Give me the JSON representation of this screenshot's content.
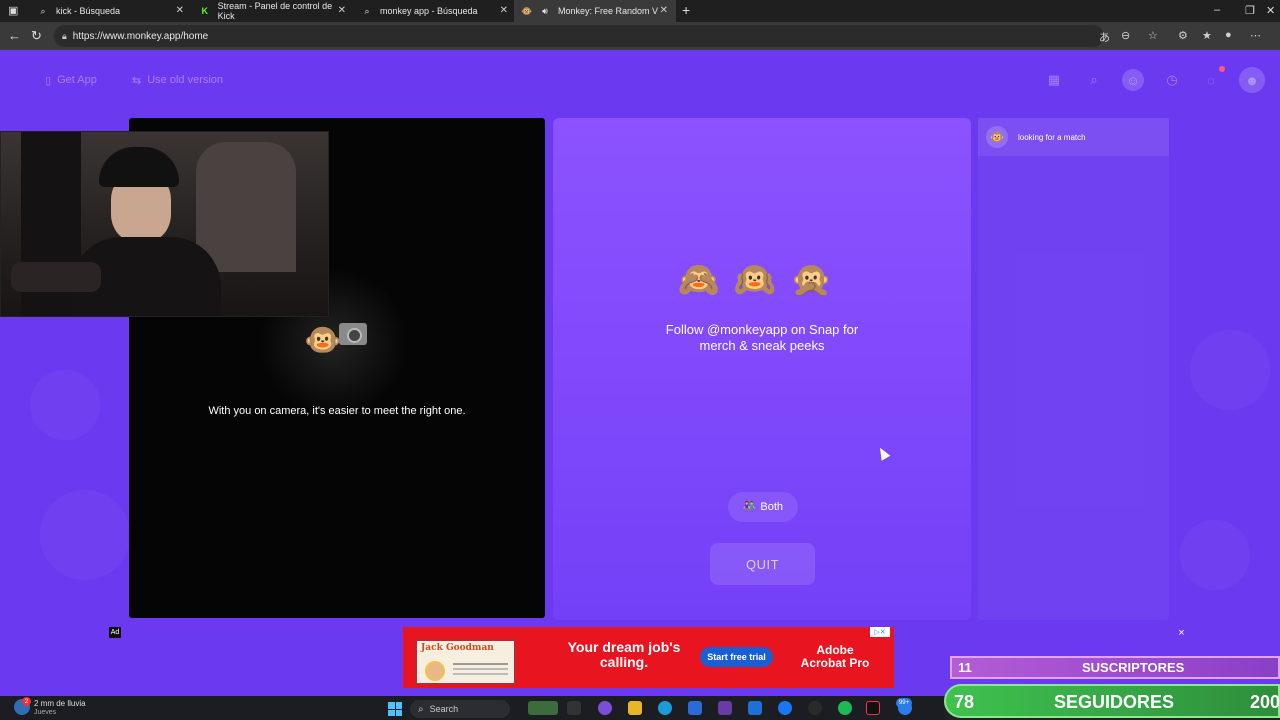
{
  "browser": {
    "tabs": [
      {
        "label": "kick - Búsqueda",
        "icon": "search-icon"
      },
      {
        "label": "Stream - Panel de control de Kick",
        "icon": "kick-icon"
      },
      {
        "label": "monkey app - Búsqueda",
        "icon": "search-icon"
      },
      {
        "label": "Monkey: Free Random Video",
        "icon": "monkey-icon"
      }
    ],
    "new_tab": "+",
    "url": "https://www.monkey.app/home"
  },
  "nav": {
    "get_app": "Get App",
    "use_old_version": "Use old version"
  },
  "video": {
    "camera_prompt": "With you on camera, it's easier to meet the right one."
  },
  "center": {
    "monkeys": "🙈🙉🙊",
    "follow_text": "Follow @monkeyapp on Snap for merch & sneak peeks",
    "both_label": "Both",
    "quit_label": "QUIT"
  },
  "chat": {
    "status": "looking for a match"
  },
  "ad": {
    "label": "Ad",
    "card_title": "Jack Goodman",
    "headline": "Your dream job's calling.",
    "cta": "Start free trial",
    "brand": "Adobe Acrobat Pro",
    "close": "×"
  },
  "overlay": {
    "subs_count": "11",
    "subs_label": "SUSCRIPTORES",
    "follow_count": "78",
    "follow_label": "SEGUIDORES",
    "follow_goal": "200"
  },
  "taskbar": {
    "weather_temp": "2 mm de lluvia",
    "weather_day": "Jueves",
    "weather_badge": "2",
    "search_placeholder": "Search",
    "notif_count": "99+"
  },
  "colors": {
    "page_bg": "#6b3af0",
    "center_panel": "#8c52ff",
    "ad_red": "#e8141f",
    "subs_purple": "#b45cd6",
    "follow_green": "#3fc24f"
  }
}
